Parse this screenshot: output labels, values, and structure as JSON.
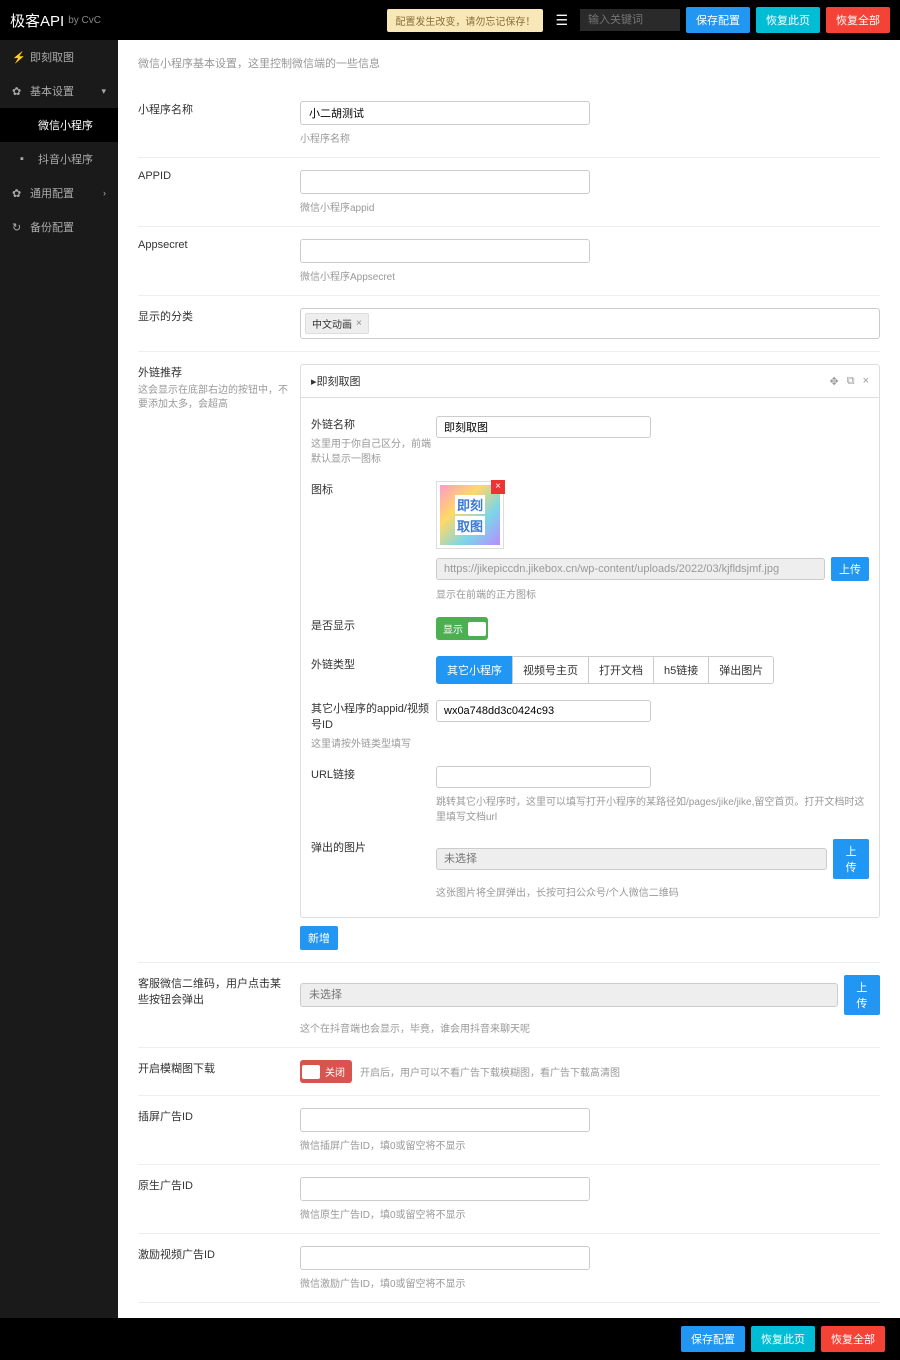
{
  "header": {
    "logo": "极客API",
    "logo_sub": "by CvC",
    "notice": "配置发生改变，请勿忘记保存！",
    "search_placeholder": "输入关键词",
    "save": "保存配置",
    "restore_page": "恢复此页",
    "restore_all": "恢复全部"
  },
  "sidebar": {
    "items": [
      {
        "icon": "⚡",
        "label": "即刻取图"
      },
      {
        "icon": "⚙",
        "label": "基本设置",
        "chev": "▾"
      },
      {
        "icon": "",
        "label": "微信小程序",
        "active": true
      },
      {
        "icon": "📹",
        "label": "抖音小程序"
      },
      {
        "icon": "⚙",
        "label": "通用配置",
        "chev": "›"
      },
      {
        "icon": "♻",
        "label": "备份配置"
      }
    ]
  },
  "page": {
    "desc": "微信小程序基本设置，这里控制微信端的一些信息",
    "rows": {
      "name": {
        "label": "小程序名称",
        "value": "小二胡测试",
        "help": "小程序名称"
      },
      "appid": {
        "label": "APPID",
        "value": "",
        "help": "微信小程序appid"
      },
      "appsecret": {
        "label": "Appsecret",
        "value": "",
        "help": "微信小程序Appsecret"
      },
      "category": {
        "label": "显示的分类",
        "tag": "中文动画"
      },
      "outlink": {
        "label": "外链推荐",
        "desc": "这会显示在底部右边的按钮中，不要添加太多，会超高",
        "panel_title": "即刻取图",
        "name_label": "外链名称",
        "name_desc": "这里用于你自己区分，前端默认显示一图标",
        "name_value": "即刻取图",
        "icon_label": "图标",
        "thumb_line1": "即刻",
        "thumb_line2": "取图",
        "icon_url": "https://jikepiccdn.jikebox.cn/wp-content/uploads/2022/03/kjfldsjmf.jpg",
        "icon_help": "显示在前端的正方图标",
        "upload": "上传",
        "show_label": "是否显示",
        "show_on": "显示",
        "type_label": "外链类型",
        "types": [
          "其它小程序",
          "视频号主页",
          "打开文档",
          "h5链接",
          "弹出图片"
        ],
        "appid_label": "其它小程序的appid/视频号ID",
        "appid_desc": "这里请按外链类型填写",
        "appid_value": "wx0a748dd3c0424c93",
        "url_label": "URL链接",
        "url_help": "跳转其它小程序时，这里可以填写打开小程序的某路径如/pages/jike/jike,留空首页。打开文档时这里填写文档url",
        "img_label": "弹出的图片",
        "img_placeholder": "未选择",
        "img_help": "这张图片将全屏弹出，长按可扫公众号/个人微信二维码",
        "add": "新增"
      },
      "qrcode": {
        "label": "客服微信二维码，用户点击某些按钮会弹出",
        "placeholder": "未选择",
        "upload": "上传",
        "help": "这个在抖音端也会显示，毕竟，谁会用抖音来聊天呢"
      },
      "blur": {
        "label": "开启模糊图下载",
        "off": "关闭",
        "help": "开启后，用户可以不看广告下载模糊图，看广告下载高清图"
      },
      "ad1": {
        "label": "插屏广告ID",
        "help": "微信插屏广告ID，填0或留空将不显示"
      },
      "ad2": {
        "label": "原生广告ID",
        "help": "微信原生广告ID，填0或留空将不显示"
      },
      "ad3": {
        "label": "激励视频广告ID",
        "help": "微信激励广告ID，填0或留空将不显示"
      }
    }
  },
  "footer": {
    "save": "保存配置",
    "restore_page": "恢复此页",
    "restore_all": "恢复全部"
  }
}
